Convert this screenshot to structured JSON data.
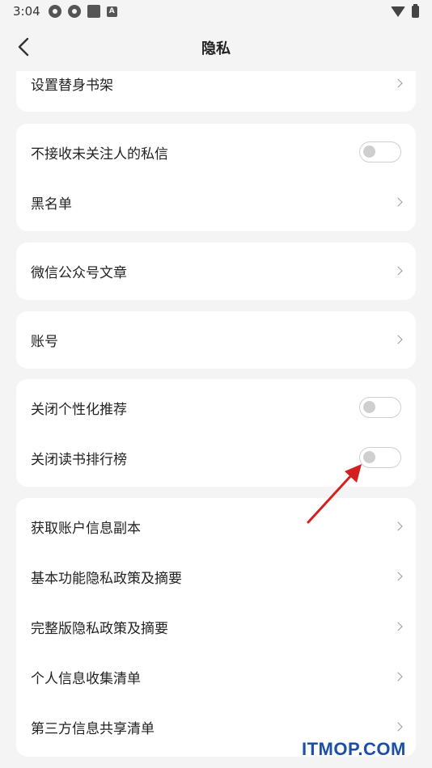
{
  "status_bar": {
    "time": "3:04",
    "icons": [
      "settings-icon",
      "settings-icon",
      "square-icon",
      "a-icon",
      "wifi-icon",
      "battery-icon"
    ]
  },
  "header": {
    "title": "隐私",
    "back_icon": "chevron-left-icon"
  },
  "groups": [
    {
      "items": [
        {
          "label": "设置替身书架",
          "type": "link"
        }
      ]
    },
    {
      "items": [
        {
          "label": "不接收未关注人的私信",
          "type": "toggle",
          "on": false
        },
        {
          "label": "黑名单",
          "type": "link"
        }
      ]
    },
    {
      "items": [
        {
          "label": "微信公众号文章",
          "type": "link"
        }
      ]
    },
    {
      "items": [
        {
          "label": "账号",
          "type": "link"
        }
      ]
    },
    {
      "items": [
        {
          "label": "关闭个性化推荐",
          "type": "toggle",
          "on": false
        },
        {
          "label": "关闭读书排行榜",
          "type": "toggle",
          "on": false
        }
      ]
    },
    {
      "items": [
        {
          "label": "获取账户信息副本",
          "type": "link"
        },
        {
          "label": "基本功能隐私政策及摘要",
          "type": "link"
        },
        {
          "label": "完整版隐私政策及摘要",
          "type": "link"
        },
        {
          "label": "个人信息收集清单",
          "type": "link"
        },
        {
          "label": "第三方信息共享清单",
          "type": "link"
        }
      ]
    }
  ],
  "watermark": "ITMOP.COM",
  "colors": {
    "background": "#f4f4f4",
    "card": "#ffffff",
    "annotation_arrow": "#d42020",
    "watermark": "#1b4fa8"
  }
}
